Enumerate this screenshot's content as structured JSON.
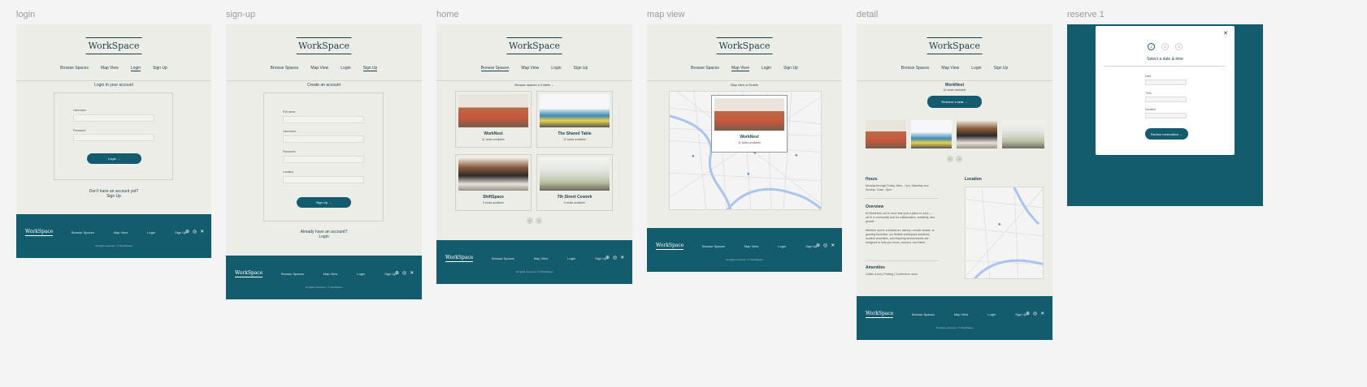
{
  "frames": {
    "login": "login",
    "signup": "sign-up",
    "home": "home",
    "map": "map view",
    "detail": "detail",
    "reserve": "reserve 1"
  },
  "brand": "WorkSpace",
  "nav": {
    "browse": "Browse Spaces",
    "map": "Map View",
    "login": "Login",
    "signup": "Sign Up"
  },
  "footer": {
    "brand": "WorkSpace",
    "browse": "Browse Spaces",
    "map": "Map View",
    "login": "Login",
    "signup": "Sign Up",
    "copy": "All rights reserved. | © WorkSpace",
    "social": [
      "⊕",
      "◎",
      "✕"
    ]
  },
  "login": {
    "title": "Login to your account",
    "username_label": "Username",
    "password_label": "Password",
    "button": "Login →",
    "prompt": "Don't have an account yet?",
    "link": "Sign Up"
  },
  "signup": {
    "title": "Create an account",
    "fullname_label": "Full name",
    "username_label": "Username",
    "password_label": "Password",
    "location_label": "Location",
    "button": "Sign Up →",
    "prompt": "Already have an account?",
    "link": "Login"
  },
  "home": {
    "title": "Browse spaces in Dublin ⌄",
    "cards": [
      {
        "name": "WorkNest",
        "sub": "11 seats available"
      },
      {
        "name": "The Shared Table",
        "sub": "19 seats available"
      },
      {
        "name": "ShiftSpace",
        "sub": "5 seats available"
      },
      {
        "name": "7th Street Cowork",
        "sub": "8 seats available"
      }
    ],
    "prev": "←",
    "next": "→"
  },
  "mapview": {
    "title": "Map view of Dublin",
    "popup_name": "WorkNest",
    "popup_sub": "11 seats available"
  },
  "detail": {
    "name": "WorkNest",
    "sub": "16 seats available",
    "button": "Reserve a seat →",
    "prev": "←",
    "next": "→",
    "hours_title": "Hours",
    "hours_text": "Monday through Friday: 8am - 7pm, Saturday and Sunday: 11am - 5pm.",
    "location_title": "Location",
    "overview_title": "Overview",
    "overview_p1": "At WorkNest, we're more than just a place to work — we're a community hub for collaboration, creativity, and growth.",
    "overview_p2": "Whether you're a freelancer, startup, remote worker, or growing business, our flexible workspace solutions, modern amenities, and inspiring environments are designed to help you focus, connect, and thrive.",
    "amenities_title": "Amenities",
    "amenities_text": "Coffee & tea | Printing | Conference room"
  },
  "reserve": {
    "steps": [
      "1",
      "2",
      "3"
    ],
    "title": "Select a date & time",
    "date_label": "Date",
    "time_label": "Time",
    "duration_label": "Duration",
    "button": "Review reservation →",
    "close": "✕"
  }
}
